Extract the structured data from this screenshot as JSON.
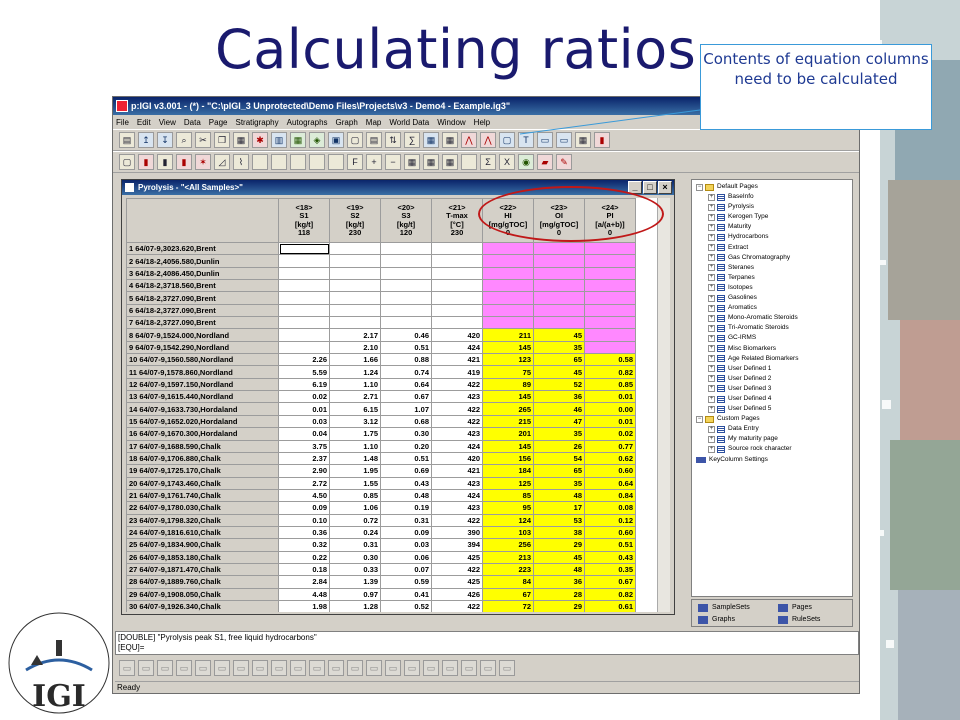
{
  "slide": {
    "title": "Calculating ratios",
    "callout": "Contents of equation columns need to be calculated"
  },
  "app": {
    "title": "p:IGI v3.001 - (*) - \"C:\\pIGI_3 Unprotected\\Demo Files\\Projects\\v3 - Demo4 - Example.ig3\"",
    "menu": [
      "File",
      "Edit",
      "View",
      "Data",
      "Page",
      "Stratigraphy",
      "Autographs",
      "Graph",
      "Map",
      "World Data",
      "Window",
      "Help"
    ]
  },
  "grid_window": {
    "title": "Pyrolysis - \"<All Samples>\"",
    "columns": [
      {
        "id": "<18>",
        "name": "S1",
        "unit": "[kg/t]",
        "code": "118"
      },
      {
        "id": "<19>",
        "name": "S2",
        "unit": "[kg/t]",
        "code": "230"
      },
      {
        "id": "<20>",
        "name": "S3",
        "unit": "[kg/t]",
        "code": "120"
      },
      {
        "id": "<21>",
        "name": "T-max",
        "unit": "[°C]",
        "code": "230"
      },
      {
        "id": "<22>",
        "name": "HI",
        "unit": "[mg/gTOC]",
        "code": "0"
      },
      {
        "id": "<23>",
        "name": "OI",
        "unit": "[mg/gTOC]",
        "code": "0"
      },
      {
        "id": "<24>",
        "name": "PI",
        "unit": "[a/(a+b)]",
        "code": "0"
      }
    ],
    "rows": [
      {
        "label": "1 64/07-9,3023.620,Brent",
        "v": [
          "",
          "",
          "",
          "",
          "",
          "",
          ""
        ],
        "type": "pink"
      },
      {
        "label": "2 64/18-2,4056.580,Dunlin",
        "v": [
          "",
          "",
          "",
          "",
          "",
          "",
          ""
        ],
        "type": "pink"
      },
      {
        "label": "3 64/18-2,4086.450,Dunlin",
        "v": [
          "",
          "",
          "",
          "",
          "",
          "",
          ""
        ],
        "type": "pink"
      },
      {
        "label": "4 64/18-2,3718.560,Brent",
        "v": [
          "",
          "",
          "",
          "",
          "",
          "",
          ""
        ],
        "type": "pink"
      },
      {
        "label": "5 64/18-2,3727.090,Brent",
        "v": [
          "",
          "",
          "",
          "",
          "",
          "",
          ""
        ],
        "type": "pink"
      },
      {
        "label": "6 64/18-2,3727.090,Brent",
        "v": [
          "",
          "",
          "",
          "",
          "",
          "",
          ""
        ],
        "type": "pink"
      },
      {
        "label": "7 64/18-2,3727.090,Brent",
        "v": [
          "",
          "",
          "",
          "",
          "",
          "",
          ""
        ],
        "type": "pink"
      },
      {
        "label": "8 64/07-9,1524.000,Nordland",
        "v": [
          "",
          "2.17",
          "0.46",
          "420",
          "211",
          "45",
          ""
        ],
        "type": "mixed"
      },
      {
        "label": "9 64/07-9,1542.290,Nordland",
        "v": [
          "",
          "2.10",
          "0.51",
          "424",
          "145",
          "35",
          ""
        ],
        "type": "mixed"
      },
      {
        "label": "10 64/07-9,1560.580,Nordland",
        "v": [
          "2.26",
          "1.66",
          "0.88",
          "421",
          "123",
          "65",
          "0.58"
        ],
        "type": "yellow"
      },
      {
        "label": "11 64/07-9,1578.860,Nordland",
        "v": [
          "5.59",
          "1.24",
          "0.74",
          "419",
          "75",
          "45",
          "0.82"
        ],
        "type": "yellow"
      },
      {
        "label": "12 64/07-9,1597.150,Nordland",
        "v": [
          "6.19",
          "1.10",
          "0.64",
          "422",
          "89",
          "52",
          "0.85"
        ],
        "type": "yellow"
      },
      {
        "label": "13 64/07-9,1615.440,Nordland",
        "v": [
          "0.02",
          "2.71",
          "0.67",
          "423",
          "145",
          "36",
          "0.01"
        ],
        "type": "yellow"
      },
      {
        "label": "14 64/07-9,1633.730,Hordaland",
        "v": [
          "0.01",
          "6.15",
          "1.07",
          "422",
          "265",
          "46",
          "0.00"
        ],
        "type": "yellow"
      },
      {
        "label": "15 64/07-9,1652.020,Hordaland",
        "v": [
          "0.03",
          "3.12",
          "0.68",
          "422",
          "215",
          "47",
          "0.01"
        ],
        "type": "yellow"
      },
      {
        "label": "16 64/07-9,1670.300,Hordaland",
        "v": [
          "0.04",
          "1.75",
          "0.30",
          "423",
          "201",
          "35",
          "0.02"
        ],
        "type": "yellow"
      },
      {
        "label": "17 64/07-9,1688.590,Chalk",
        "v": [
          "3.75",
          "1.10",
          "0.20",
          "424",
          "145",
          "26",
          "0.77"
        ],
        "type": "yellow"
      },
      {
        "label": "18 64/07-9,1706.880,Chalk",
        "v": [
          "2.37",
          "1.48",
          "0.51",
          "420",
          "156",
          "54",
          "0.62"
        ],
        "type": "yellow"
      },
      {
        "label": "19 64/07-9,1725.170,Chalk",
        "v": [
          "2.90",
          "1.95",
          "0.69",
          "421",
          "184",
          "65",
          "0.60"
        ],
        "type": "yellow"
      },
      {
        "label": "20 64/07-9,1743.460,Chalk",
        "v": [
          "2.72",
          "1.55",
          "0.43",
          "423",
          "125",
          "35",
          "0.64"
        ],
        "type": "yellow"
      },
      {
        "label": "21 64/07-9,1761.740,Chalk",
        "v": [
          "4.50",
          "0.85",
          "0.48",
          "424",
          "85",
          "48",
          "0.84"
        ],
        "type": "yellow"
      },
      {
        "label": "22 64/07-9,1780.030,Chalk",
        "v": [
          "0.09",
          "1.06",
          "0.19",
          "423",
          "95",
          "17",
          "0.08"
        ],
        "type": "yellow"
      },
      {
        "label": "23 64/07-9,1798.320,Chalk",
        "v": [
          "0.10",
          "0.72",
          "0.31",
          "422",
          "124",
          "53",
          "0.12"
        ],
        "type": "yellow"
      },
      {
        "label": "24 64/07-9,1816.610,Chalk",
        "v": [
          "0.36",
          "0.24",
          "0.09",
          "390",
          "103",
          "38",
          "0.60"
        ],
        "type": "yellow"
      },
      {
        "label": "25 64/07-9,1834.900,Chalk",
        "v": [
          "0.32",
          "0.31",
          "0.03",
          "394",
          "256",
          "29",
          "0.51"
        ],
        "type": "yellow"
      },
      {
        "label": "26 64/07-9,1853.180,Chalk",
        "v": [
          "0.22",
          "0.30",
          "0.06",
          "425",
          "213",
          "45",
          "0.43"
        ],
        "type": "yellow"
      },
      {
        "label": "27 64/07-9,1871.470,Chalk",
        "v": [
          "0.18",
          "0.33",
          "0.07",
          "422",
          "223",
          "48",
          "0.35"
        ],
        "type": "yellow"
      },
      {
        "label": "28 64/07-9,1889.760,Chalk",
        "v": [
          "2.84",
          "1.39",
          "0.59",
          "425",
          "84",
          "36",
          "0.67"
        ],
        "type": "yellow"
      },
      {
        "label": "29 64/07-9,1908.050,Chalk",
        "v": [
          "4.48",
          "0.97",
          "0.41",
          "426",
          "67",
          "28",
          "0.82"
        ],
        "type": "yellow"
      },
      {
        "label": "30 64/07-9,1926.340,Chalk",
        "v": [
          "1.98",
          "1.28",
          "0.52",
          "422",
          "72",
          "29",
          "0.61"
        ],
        "type": "yellow"
      }
    ]
  },
  "tree": {
    "items": [
      {
        "label": "Default Pages",
        "level": 0,
        "icon": "folder"
      },
      {
        "label": "BaseInfo",
        "level": 1,
        "icon": "grid"
      },
      {
        "label": "Pyrolysis",
        "level": 1,
        "icon": "grid"
      },
      {
        "label": "Kerogen Type",
        "level": 1,
        "icon": "grid"
      },
      {
        "label": "Maturity",
        "level": 1,
        "icon": "grid"
      },
      {
        "label": "Hydrocarbons",
        "level": 1,
        "icon": "grid"
      },
      {
        "label": "Extract",
        "level": 1,
        "icon": "grid"
      },
      {
        "label": "Gas Chromatography",
        "level": 1,
        "icon": "grid"
      },
      {
        "label": "Steranes",
        "level": 1,
        "icon": "grid"
      },
      {
        "label": "Terpanes",
        "level": 1,
        "icon": "grid"
      },
      {
        "label": "Isotopes",
        "level": 1,
        "icon": "grid"
      },
      {
        "label": "Gasolines",
        "level": 1,
        "icon": "grid"
      },
      {
        "label": "Aromatics",
        "level": 1,
        "icon": "grid"
      },
      {
        "label": "Mono-Aromatic Steroids",
        "level": 1,
        "icon": "grid"
      },
      {
        "label": "Tri-Aromatic Steroids",
        "level": 1,
        "icon": "grid"
      },
      {
        "label": "GC-IRMS",
        "level": 1,
        "icon": "grid"
      },
      {
        "label": "Misc Biomarkers",
        "level": 1,
        "icon": "grid"
      },
      {
        "label": "Age Related Biomarkers",
        "level": 1,
        "icon": "grid"
      },
      {
        "label": "User Defined 1",
        "level": 1,
        "icon": "grid"
      },
      {
        "label": "User Defined 2",
        "level": 1,
        "icon": "grid"
      },
      {
        "label": "User Defined 3",
        "level": 1,
        "icon": "grid"
      },
      {
        "label": "User Defined 4",
        "level": 1,
        "icon": "grid"
      },
      {
        "label": "User Defined 5",
        "level": 1,
        "icon": "grid"
      },
      {
        "label": "Custom Pages",
        "level": 0,
        "icon": "folder"
      },
      {
        "label": "Data Entry",
        "level": 1,
        "icon": "grid"
      },
      {
        "label": "My maturity page",
        "level": 1,
        "icon": "grid"
      },
      {
        "label": "Source rock character",
        "level": 1,
        "icon": "grid"
      },
      {
        "label": "KeyColumn Settings",
        "level": 0,
        "icon": "key"
      }
    ],
    "tabs": {
      "samplesets": "SampleSets",
      "pages": "Pages",
      "graphs": "Graphs",
      "rulesets": "RuleSets"
    }
  },
  "formula": {
    "line1": "[DOUBLE] \"Pyrolysis peak S1, free liquid hydrocarbons\"",
    "line2": "[EQU]="
  },
  "status": "Ready",
  "colors": {
    "pink": "#ff88ff",
    "yellow": "#ffff00",
    "title_blue": "#1a1a6e",
    "oval_red": "#c01818"
  }
}
